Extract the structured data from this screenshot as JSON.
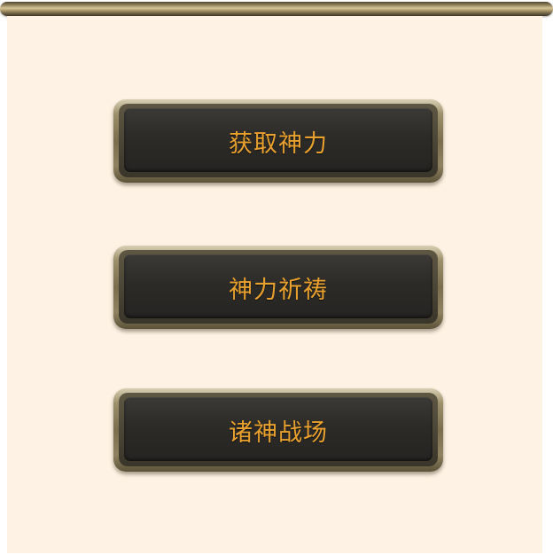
{
  "buttons": [
    {
      "label": "获取神力"
    },
    {
      "label": "神力祈祷"
    },
    {
      "label": "诸神战场"
    }
  ],
  "colors": {
    "panel_background": "#fdf2e3",
    "button_text": "#e8a02e",
    "button_face": "#2c2b28",
    "frame_gold": "#9c8f6a"
  }
}
